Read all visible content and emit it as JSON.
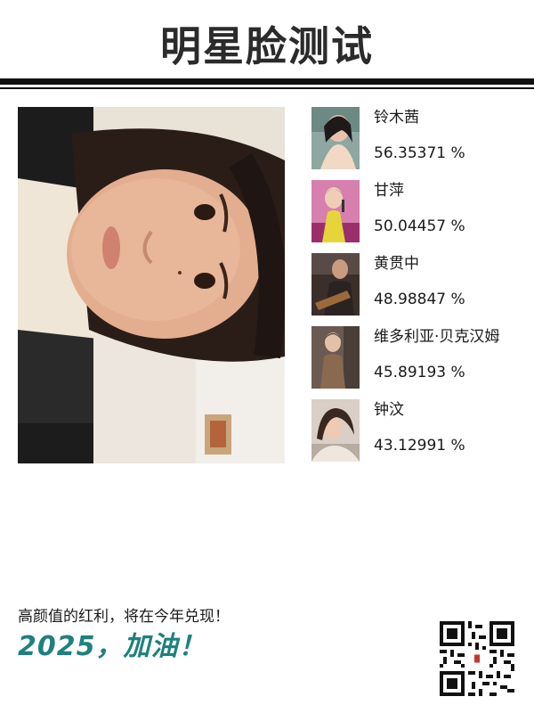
{
  "header": {
    "title": "明星脸测试"
  },
  "photo": {
    "icon": "user-face-photo"
  },
  "results": [
    {
      "name": "铃木茜",
      "score": "56.35371 %",
      "icon": "celebrity-photo-1"
    },
    {
      "name": "甘萍",
      "score": "50.04457 %",
      "icon": "celebrity-photo-2"
    },
    {
      "name": "黄贯中",
      "score": "48.98847 %",
      "icon": "celebrity-photo-3"
    },
    {
      "name": "维多利亚·贝克汉姆",
      "score": "45.89193 %",
      "icon": "celebrity-photo-4"
    },
    {
      "name": "钟汶",
      "score": "43.12991 %",
      "icon": "celebrity-photo-5"
    }
  ],
  "footer": {
    "tagline": "高颜值的红利，将在今年兑现！",
    "motto": "2025，加油！",
    "qr_icon": "qr-code-icon"
  },
  "colors": {
    "title": "#2b2b2b",
    "rule": "#111111",
    "motto": "#1f8080"
  }
}
